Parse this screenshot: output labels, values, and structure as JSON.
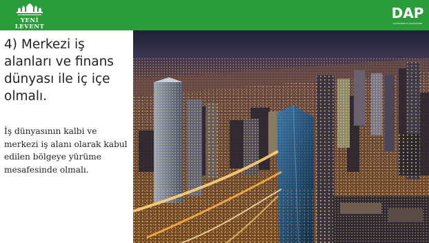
{
  "header": {
    "left_logo_text": "YENİ LEVENT",
    "right_logo_text": "DAP",
    "right_logo_tagline": "GAYRİMENKUL GELİŞTİRME",
    "background_color": "#2a9d3a"
  },
  "slide": {
    "title": "4) Merkezi iş alanları ve finans dünyası ile iç içe olmalı.",
    "body": "İş dünyasının kalbi ve merkezi  iş alanı olarak kabul edilen bölgeye yürüme mesafesinde olmalı."
  },
  "photo": {
    "subject": "Aerial night view of city skyline with illuminated skyscrapers and highways"
  }
}
